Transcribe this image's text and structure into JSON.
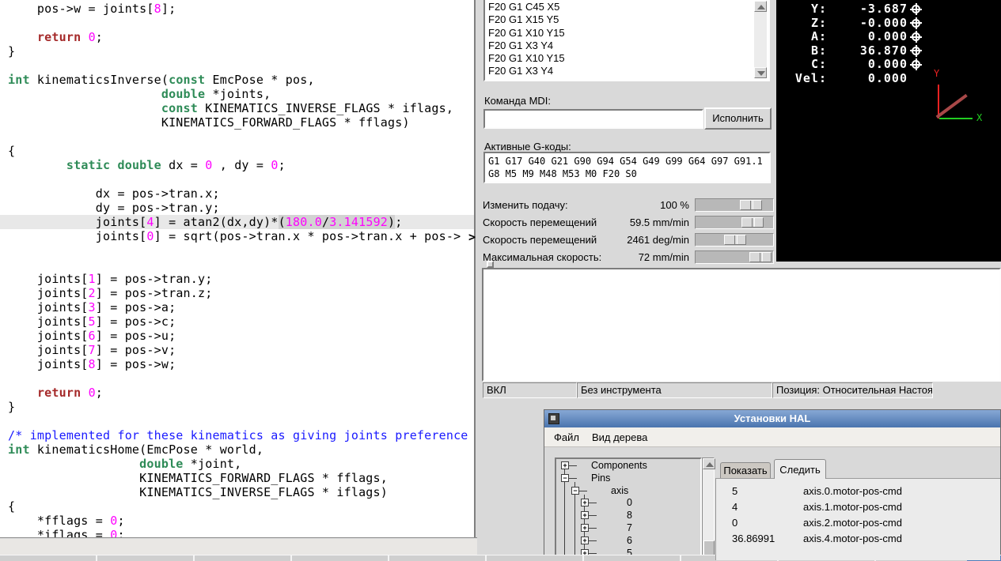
{
  "editor": {
    "wrap_marker": ">",
    "syntax_colors": {
      "keyword": "#a52a2a",
      "type": "#2e8b57",
      "number": "#ff00ff",
      "comment": "#1a1aff",
      "current_line_bg": "#e8e8e8",
      "match_bg": "#d2d2d2"
    },
    "lines": [
      {
        "hl": false,
        "t": [
          [
            "p",
            "    pos->w = joints["
          ],
          [
            "n",
            "8"
          ],
          [
            "p",
            "];"
          ]
        ]
      },
      {
        "hl": false,
        "t": []
      },
      {
        "hl": false,
        "t": [
          [
            "p",
            "    "
          ],
          [
            "k",
            "return"
          ],
          [
            "p",
            " "
          ],
          [
            "n",
            "0"
          ],
          [
            "p",
            ";"
          ]
        ]
      },
      {
        "hl": false,
        "t": [
          [
            "p",
            "}"
          ]
        ]
      },
      {
        "hl": false,
        "t": []
      },
      {
        "hl": false,
        "t": [
          [
            "t",
            "int"
          ],
          [
            "p",
            " kinematicsInverse("
          ],
          [
            "t",
            "const"
          ],
          [
            "p",
            " EmcPose * pos,"
          ]
        ]
      },
      {
        "hl": false,
        "t": [
          [
            "p",
            "                     "
          ],
          [
            "t",
            "double"
          ],
          [
            "p",
            " *joints,"
          ]
        ]
      },
      {
        "hl": false,
        "t": [
          [
            "p",
            "                     "
          ],
          [
            "t",
            "const"
          ],
          [
            "p",
            " KINEMATICS_INVERSE_FLAGS * iflags,"
          ]
        ]
      },
      {
        "hl": false,
        "t": [
          [
            "p",
            "                     KINEMATICS_FORWARD_FLAGS * fflags)"
          ]
        ]
      },
      {
        "hl": false,
        "t": []
      },
      {
        "hl": false,
        "t": [
          [
            "p",
            "{"
          ]
        ]
      },
      {
        "hl": false,
        "t": [
          [
            "p",
            "        "
          ],
          [
            "t",
            "static"
          ],
          [
            "p",
            " "
          ],
          [
            "t",
            "double"
          ],
          [
            "p",
            " dx = "
          ],
          [
            "n",
            "0"
          ],
          [
            "p",
            " , dy = "
          ],
          [
            "n",
            "0"
          ],
          [
            "p",
            ";"
          ]
        ]
      },
      {
        "hl": false,
        "t": []
      },
      {
        "hl": false,
        "t": [
          [
            "p",
            "            dx = pos->tran.x;"
          ]
        ]
      },
      {
        "hl": false,
        "t": [
          [
            "p",
            "            dy = pos->tran.y;"
          ]
        ]
      },
      {
        "hl": true,
        "t": [
          [
            "p",
            "            joints["
          ],
          [
            "n",
            "4"
          ],
          [
            "p",
            "] = atan2(dx,dy)*"
          ],
          [
            "pg",
            "("
          ],
          [
            "ng",
            "180.0"
          ],
          [
            "pg",
            "/"
          ],
          [
            "ng",
            "3.141592"
          ],
          [
            "pg",
            ")"
          ],
          [
            "p",
            ";"
          ]
        ]
      },
      {
        "hl": false,
        "t": [
          [
            "p",
            "            joints["
          ],
          [
            "n",
            "0"
          ],
          [
            "p",
            "] = sqrt(pos->tran.x * pos->tran.x + pos->"
          ]
        ]
      },
      {
        "hl": false,
        "t": []
      },
      {
        "hl": false,
        "t": []
      },
      {
        "hl": false,
        "t": [
          [
            "p",
            "    joints["
          ],
          [
            "n",
            "1"
          ],
          [
            "p",
            "] = pos->tran.y;"
          ]
        ]
      },
      {
        "hl": false,
        "t": [
          [
            "p",
            "    joints["
          ],
          [
            "n",
            "2"
          ],
          [
            "p",
            "] = pos->tran.z;"
          ]
        ]
      },
      {
        "hl": false,
        "t": [
          [
            "p",
            "    joints["
          ],
          [
            "n",
            "3"
          ],
          [
            "p",
            "] = pos->a;"
          ]
        ]
      },
      {
        "hl": false,
        "t": [
          [
            "p",
            "    joints["
          ],
          [
            "n",
            "5"
          ],
          [
            "p",
            "] = pos->c;"
          ]
        ]
      },
      {
        "hl": false,
        "t": [
          [
            "p",
            "    joints["
          ],
          [
            "n",
            "6"
          ],
          [
            "p",
            "] = pos->u;"
          ]
        ]
      },
      {
        "hl": false,
        "t": [
          [
            "p",
            "    joints["
          ],
          [
            "n",
            "7"
          ],
          [
            "p",
            "] = pos->v;"
          ]
        ]
      },
      {
        "hl": false,
        "t": [
          [
            "p",
            "    joints["
          ],
          [
            "n",
            "8"
          ],
          [
            "p",
            "] = pos->w;"
          ]
        ]
      },
      {
        "hl": false,
        "t": []
      },
      {
        "hl": false,
        "t": [
          [
            "p",
            "    "
          ],
          [
            "k",
            "return"
          ],
          [
            "p",
            " "
          ],
          [
            "n",
            "0"
          ],
          [
            "p",
            ";"
          ]
        ]
      },
      {
        "hl": false,
        "t": [
          [
            "p",
            "}"
          ]
        ]
      },
      {
        "hl": false,
        "t": []
      },
      {
        "hl": false,
        "t": [
          [
            "c",
            "/* implemented for these kinematics as giving joints preference */"
          ]
        ]
      },
      {
        "hl": false,
        "t": [
          [
            "t",
            "int"
          ],
          [
            "p",
            " kinematicsHome(EmcPose * world,"
          ]
        ]
      },
      {
        "hl": false,
        "t": [
          [
            "p",
            "                  "
          ],
          [
            "t",
            "double"
          ],
          [
            "p",
            " *joint,"
          ]
        ]
      },
      {
        "hl": false,
        "t": [
          [
            "p",
            "                  KINEMATICS_FORWARD_FLAGS * fflags,"
          ]
        ]
      },
      {
        "hl": false,
        "t": [
          [
            "p",
            "                  KINEMATICS_INVERSE_FLAGS * iflags)"
          ]
        ]
      },
      {
        "hl": false,
        "t": [
          [
            "p",
            "{"
          ]
        ]
      },
      {
        "hl": false,
        "t": [
          [
            "p",
            "    *fflags = "
          ],
          [
            "n",
            "0"
          ],
          [
            "p",
            ";"
          ]
        ]
      },
      {
        "hl": false,
        "t": [
          [
            "p",
            "    *iflags = "
          ],
          [
            "n",
            "0"
          ],
          [
            "p",
            ";"
          ]
        ]
      }
    ]
  },
  "axis_panel": {
    "mdi_history": [
      "F20 G1 C45 X5",
      "F20 G1 X15 Y5",
      "F20 G1 X10 Y15",
      "F20 G1 X3 Y4",
      "F20 G1 X10 Y15",
      "F20 G1 X3 Y4"
    ],
    "mdi_label": "Команда MDI:",
    "mdi_value": "",
    "execute_button": "Исполнить",
    "gcodes_label": "Активные G-коды:",
    "active_gcodes_line1": "G1 G17 G40 G21 G90 G94 G54 G49 G99 G64 G97 G91.1",
    "active_gcodes_line2": "G8 M5 M9 M48 M53 M0 F20 S0",
    "overrides": [
      {
        "label": "Изменить подачу:",
        "value": "100 %",
        "fraction": 0.8
      },
      {
        "label": "Скорость перемещений",
        "value": "59.5 mm/min",
        "fraction": 0.82
      },
      {
        "label": "Скорость перемещений",
        "value": "2461 deg/min",
        "fraction": 0.5
      },
      {
        "label": "Максимальная скорость:",
        "value": "72 mm/min",
        "fraction": 0.97
      }
    ],
    "status_cells": [
      "ВКЛ",
      "Без инструмента",
      "Позиция: Относительная Настоящая"
    ],
    "dro": {
      "rows": [
        {
          "label": "Y:",
          "value": "-3.687",
          "homed": true
        },
        {
          "label": "Z:",
          "value": "-0.000",
          "homed": true
        },
        {
          "label": "A:",
          "value": "0.000",
          "homed": true
        },
        {
          "label": "B:",
          "value": "36.870",
          "homed": true
        },
        {
          "label": "C:",
          "value": "0.000",
          "homed": true
        },
        {
          "label": "Vel:",
          "value": "0.000",
          "homed": false
        }
      ],
      "axis_labels": {
        "x": "X",
        "y": "Y"
      },
      "colors": {
        "x_axis": "#22cc22",
        "y_axis": "#ee2222",
        "rotated_axis": "#a84848"
      }
    }
  },
  "hal_window": {
    "title": "Установки HAL",
    "titlebar_colors": {
      "top": "#87a8d5",
      "bottom": "#4a74ae"
    },
    "menu": [
      "Файл",
      "Вид дерева"
    ],
    "tree": [
      {
        "label": "Components",
        "expander": "+",
        "depth": 0
      },
      {
        "label": "Pins",
        "expander": "-",
        "depth": 0
      },
      {
        "label": "axis",
        "expander": "-",
        "depth": 1
      },
      {
        "label": "0",
        "expander": "+",
        "depth": 2
      },
      {
        "label": "8",
        "expander": "+",
        "depth": 2
      },
      {
        "label": "7",
        "expander": "+",
        "depth": 2
      },
      {
        "label": "6",
        "expander": "+",
        "depth": 2
      },
      {
        "label": "5",
        "expander": "+",
        "depth": 2
      }
    ],
    "tabs": [
      {
        "label": "Показать",
        "active": false
      },
      {
        "label": "Следить",
        "active": true
      }
    ],
    "watch": [
      {
        "value": "5",
        "pin": "axis.0.motor-pos-cmd"
      },
      {
        "value": "4",
        "pin": "axis.1.motor-pos-cmd"
      },
      {
        "value": "0",
        "pin": "axis.2.motor-pos-cmd"
      },
      {
        "value": "36.86991",
        "pin": "axis.4.motor-pos-cmd"
      }
    ]
  },
  "taskbar": {
    "accent_color": "#4f7cba"
  }
}
